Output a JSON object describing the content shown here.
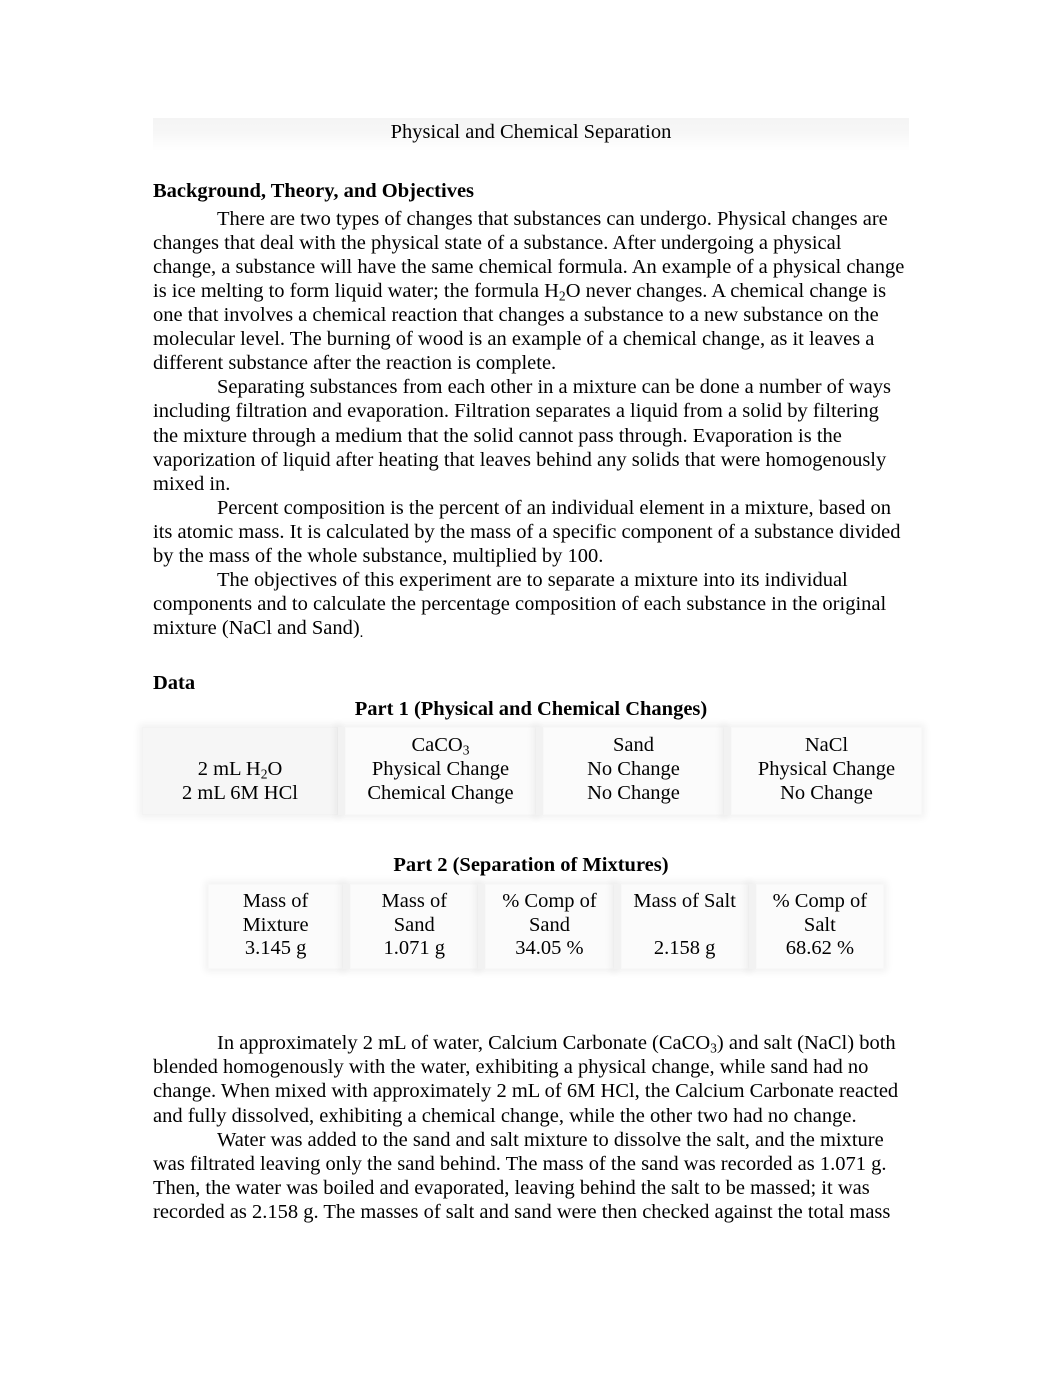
{
  "document": {
    "title": "Physical and Chemical Separation"
  },
  "sections": {
    "background": {
      "heading": "Background, Theory, and Objectives",
      "paragraphs": {
        "p1_a": "There are two types of changes that substances can undergo. Physical changes are changes that deal with the physical state of a substance. After undergoing a physical change, a substance will have the same chemical formula. An example of a physical change is ice melting to form liquid water; the formula H",
        "p1_sub": "2",
        "p1_b": "O never changes. A chemical change is one that involves a chemical reaction that changes a substance to a new substance on the molecular level. The burning of wood is an example of a chemical change, as it leaves a different substance after the reaction is complete.",
        "p2": "Separating substances from each other in a mixture can be done a number of ways including filtration and evaporation. Filtration separates a liquid from a solid by filtering the mixture through a medium that the solid cannot pass through. Evaporation is the vaporization of liquid after heating that leaves behind any solids that were homogenously mixed in.",
        "p3": "Percent composition is the percent of an individual element in a mixture, based on its atomic mass. It is calculated by the mass of a specific component of a substance divided by the mass of the whole substance, multiplied by 100.",
        "p4": "The objectives of this experiment are to separate a mixture into its individual components and to calculate the percentage composition of each substance in the original mixture (NaCl and Sand)",
        "p4_period": "."
      }
    },
    "data": {
      "heading": "Data",
      "part1": {
        "caption": "Part 1 (Physical and Chemical Changes)",
        "corner_label": "",
        "column_headers": [
          "CaCO",
          "Sand",
          "NaCl"
        ],
        "caco3_subscript": "3",
        "row_labels": [
          "2 mL H",
          "2 mL 6M HCl"
        ],
        "row1_label_sub": "2",
        "row1_label_tail": "O",
        "rows": [
          [
            "Physical Change",
            "No Change",
            "Physical Change"
          ],
          [
            "Chemical Change",
            "No Change",
            "No Change"
          ]
        ]
      },
      "part2": {
        "caption": "Part 2 (Separation of Mixtures)",
        "headers": [
          {
            "line1": "Mass of",
            "line2": "Mixture"
          },
          {
            "line1": "Mass of",
            "line2": "Sand"
          },
          {
            "line1": "% Comp of",
            "line2": "Sand"
          },
          {
            "line1": "Mass of Salt",
            "line2": ""
          },
          {
            "line1": "% Comp of",
            "line2": "Salt"
          }
        ],
        "values": [
          "3.145 g",
          "1.071 g",
          "34.05 %",
          "2.158 g",
          "68.62 %"
        ]
      }
    },
    "discussion": {
      "p1_a": "In approximately 2 mL of water, Calcium Carbonate (CaCO",
      "p1_sub": "3",
      "p1_b": ") and salt (NaCl) both blended homogenously with the water, exhibiting a physical change, while sand had no change. When mixed with approximately 2 mL of 6M HCl, the Calcium Carbonate reacted and fully dissolved, exhibiting a chemical change, while the other two had no change.",
      "p2": "Water was added to the sand and salt mixture to dissolve the salt, and the mixture was filtrated leaving only the sand behind. The mass of the sand was recorded as 1.071 g. Then, the water was boiled and evaporated, leaving behind the salt to be massed; it was recorded as 2.158 g. The masses of salt and sand were then checked against the total mass"
    }
  }
}
